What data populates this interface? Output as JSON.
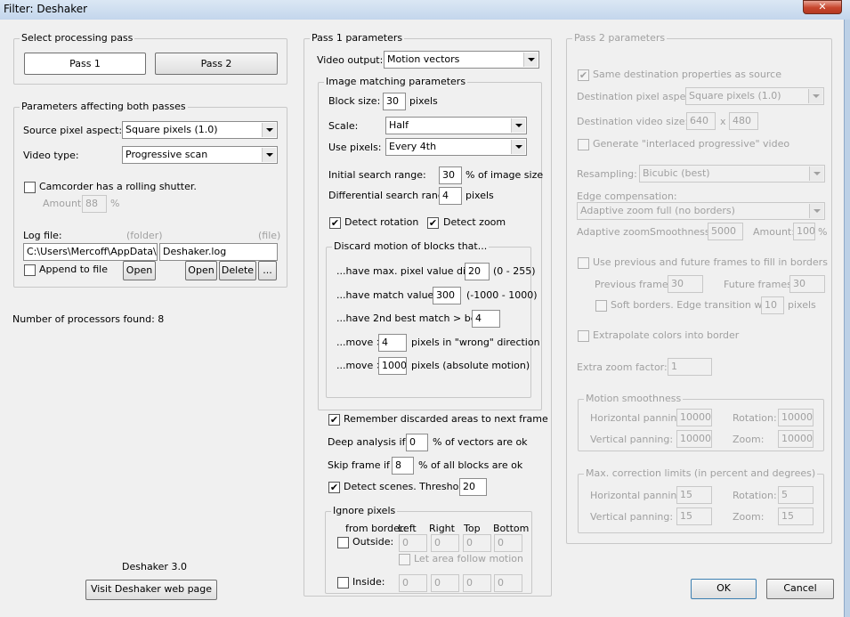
{
  "window": {
    "title": "Filter: Deshaker",
    "close": "✕"
  },
  "left": {
    "pass_group": {
      "label": "Select processing pass",
      "pass1": "Pass 1",
      "pass2": "Pass 2"
    },
    "both": {
      "label": "Parameters affecting both passes",
      "source_pixel_aspect_label": "Source pixel aspect:",
      "source_pixel_aspect_value": "Square pixels  (1.0)",
      "video_type_label": "Video type:",
      "video_type_value": "Progressive scan",
      "camcorder_label": "Camcorder has a rolling shutter.",
      "amount_label": "Amount:",
      "amount_value": "88",
      "amount_unit": "%",
      "log_file_label": "Log file:",
      "folder_hint": "(folder)",
      "file_hint": "(file)",
      "folder_value": "C:\\Users\\Mercoff\\AppData\\Lc",
      "file_value": "Deshaker.log",
      "append_label": "Append to file",
      "open1": "Open",
      "open2": "Open",
      "delete": "Delete",
      "browse": "..."
    },
    "processors": "Number of processors found:  8",
    "version": "Deshaker 3.0",
    "visit": "Visit Deshaker web page"
  },
  "pass1": {
    "label": "Pass 1 parameters",
    "video_output_label": "Video output:",
    "video_output_value": "Motion vectors",
    "img": {
      "label": "Image matching parameters",
      "block_size_label": "Block size:",
      "block_size_value": "30",
      "block_size_unit": "pixels",
      "scale_label": "Scale:",
      "scale_value": "Half",
      "use_pixels_label": "Use pixels:",
      "use_pixels_value": "Every 4th",
      "init_range_label": "Initial search range:",
      "init_range_value": "30",
      "init_range_unit": "% of image size",
      "diff_range_label": "Differential search range:",
      "diff_range_value": "4",
      "diff_range_unit": "pixels",
      "detect_rotation": "Detect rotation",
      "detect_zoom": "Detect zoom",
      "discard": {
        "label": "Discard motion of blocks that...",
        "r1_pre": "...have max. pixel value diff. <",
        "r1_val": "20",
        "r1_post": "(0 - 255)",
        "r2_pre": "...have match value <",
        "r2_val": "300",
        "r2_post": "(-1000 - 1000)",
        "r3_pre": "...have 2nd best match > best -",
        "r3_val": "4",
        "r4_pre": "...move >",
        "r4_val": "4",
        "r4_post": "pixels in \"wrong\" direction",
        "r5_pre": "...move >",
        "r5_val": "1000",
        "r5_post": "pixels (absolute motion)"
      }
    },
    "remember": "Remember discarded areas to next frame",
    "deep_pre": "Deep analysis if <",
    "deep_val": "0",
    "deep_post": "% of vectors are ok",
    "skip_pre": "Skip frame if <",
    "skip_val": "8",
    "skip_post": "% of all blocks are ok",
    "detect_scenes": "Detect scenes. Threshold:",
    "threshold_val": "20",
    "ignore": {
      "label": "Ignore pixels",
      "from_border": "from border:",
      "left": "Left",
      "right": "Right",
      "top": "Top",
      "bottom": "Bottom",
      "outside": "Outside:",
      "inside": "Inside:",
      "outside_vals": [
        "0",
        "0",
        "0",
        "0"
      ],
      "inside_vals": [
        "0",
        "0",
        "0",
        "0"
      ],
      "follow": "Let area follow motion"
    }
  },
  "pass2": {
    "label": "Pass 2 parameters",
    "same_dest": "Same destination properties as source",
    "dest_aspect_label": "Destination pixel aspect:",
    "dest_aspect_value": "Square pixels  (1.0)",
    "dest_size_label": "Destination video size:",
    "dest_w": "640",
    "dest_x": "x",
    "dest_h": "480",
    "interlaced": "Generate \"interlaced progressive\" video",
    "resampling_label": "Resampling:",
    "resampling_value": "Bicubic  (best)",
    "edge_label": "Edge compensation:",
    "edge_value": "Adaptive zoom full  (no borders)",
    "az_label": "Adaptive zoom:",
    "smooth_label": "Smoothness:",
    "smooth_val": "5000",
    "amount_label": "Amount:",
    "amount_val": "100",
    "amount_unit": "%",
    "use_prev": "Use previous and future frames to fill in borders",
    "prev_frames_label": "Previous frames:",
    "prev_frames_val": "30",
    "future_frames_label": "Future frames:",
    "future_frames_val": "30",
    "soft_borders": "Soft borders. Edge transition width:",
    "soft_val": "10",
    "soft_unit": "pixels",
    "extrapolate": "Extrapolate colors into border",
    "extra_zoom_label": "Extra zoom factor:",
    "extra_zoom_val": "1",
    "smoothness": {
      "label": "Motion smoothness",
      "hpan_label": "Horizontal panning:",
      "hpan_val": "10000",
      "rot_label": "Rotation:",
      "rot_val": "10000",
      "vpan_label": "Vertical panning:",
      "vpan_val": "10000",
      "zoom_label": "Zoom:",
      "zoom_val": "10000"
    },
    "limits": {
      "label": "Max. correction limits (in percent and degrees)",
      "hpan_label": "Horizontal panning:",
      "hpan_val": "15",
      "rot_label": "Rotation:",
      "rot_val": "5",
      "vpan_label": "Vertical panning:",
      "vpan_val": "15",
      "zoom_label": "Zoom:",
      "zoom_val": "15"
    }
  },
  "ok": "OK",
  "cancel": "Cancel"
}
